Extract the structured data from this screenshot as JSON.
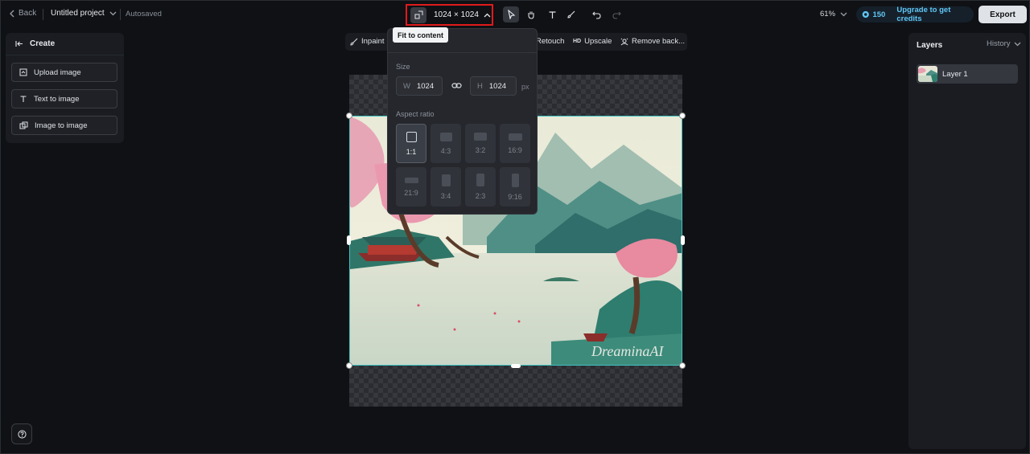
{
  "header": {
    "back_label": "Back",
    "project_title": "Untitled project",
    "autosave_status": "Autosaved",
    "canvas_size": "1024 × 1024",
    "zoom": "61%",
    "credits": "150",
    "upgrade_label": "Upgrade to get credits",
    "export_label": "Export"
  },
  "tooltip": {
    "fit_to_content": "Fit to content"
  },
  "left_panel": {
    "title": "Create",
    "items": [
      {
        "label": "Upload image",
        "icon": "upload-image-icon"
      },
      {
        "label": "Text to image",
        "icon": "text-to-image-icon"
      },
      {
        "label": "Image to image",
        "icon": "image-to-image-icon"
      }
    ]
  },
  "edit_toolbar": {
    "inpaint": "Inpaint",
    "retouch": "Retouch",
    "upscale_badge": "HD",
    "upscale": "Upscale",
    "remove_background": "Remove back..."
  },
  "size_popup": {
    "size_label": "Size",
    "width_key": "W",
    "width_value": "1024",
    "height_key": "H",
    "height_value": "1024",
    "unit": "px",
    "aspect_label": "Aspect ratio",
    "ratios": [
      "1:1",
      "4:3",
      "3:2",
      "16:9",
      "21:9",
      "3:4",
      "2:3",
      "9:16"
    ],
    "selected_ratio": "1:1"
  },
  "canvas": {
    "watermark": "DreaminaAI"
  },
  "right_panel": {
    "layers_tab": "Layers",
    "history_tab": "History",
    "layers": [
      "Layer 1"
    ]
  },
  "colors": {
    "accent": "#5fc7f5",
    "highlight_border": "#e01b1b",
    "selection": "#3fc2c0"
  }
}
